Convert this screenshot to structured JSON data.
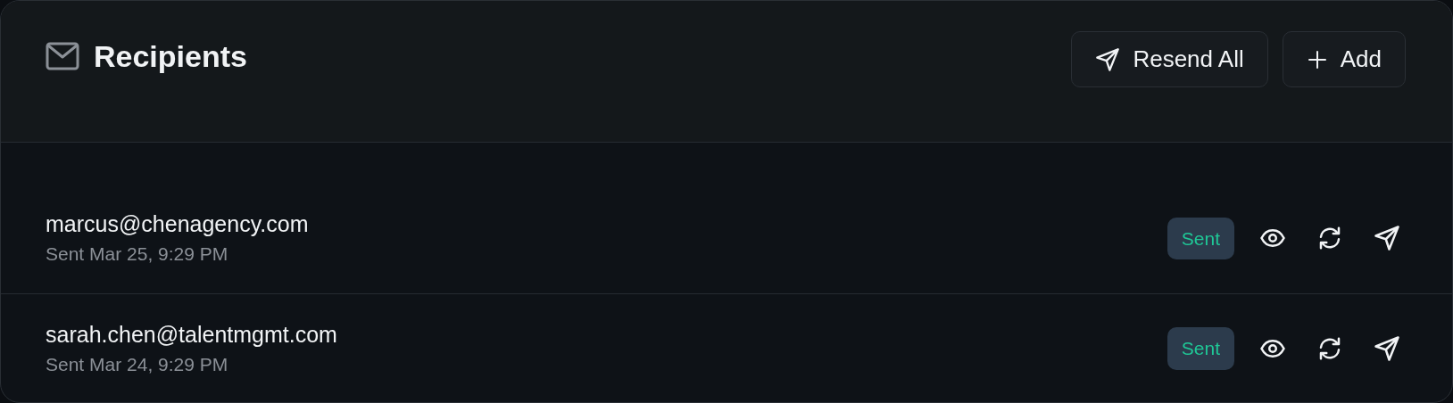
{
  "header": {
    "title": "Recipients",
    "buttons": [
      {
        "label": "Resend All",
        "kind": "send"
      },
      {
        "label": "Add",
        "kind": "add"
      }
    ]
  },
  "recipients": [
    {
      "email": "marcus@chenagency.com",
      "sent_at": "Sent Mar 25, 9:29 PM",
      "status": "Sent",
      "kind": "sent"
    },
    {
      "email": "sarah.chen@talentmgmt.com",
      "sent_at": "Sent Mar 24, 9:29 PM",
      "status": "Sent",
      "kind": "sent"
    }
  ]
}
